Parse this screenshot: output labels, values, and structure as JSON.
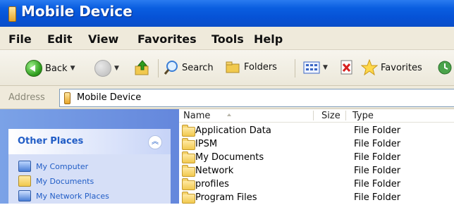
{
  "window": {
    "title": "Mobile Device"
  },
  "menubar": {
    "items": [
      "File",
      "Edit",
      "View",
      "Favorites",
      "Tools",
      "Help"
    ]
  },
  "toolbar": {
    "back_label": "Back",
    "search_label": "Search",
    "folders_label": "Folders",
    "favorites_label": "Favorites"
  },
  "address": {
    "label": "Address",
    "value": "Mobile Device"
  },
  "other_places": {
    "title": "Other Places",
    "items": [
      "My Computer",
      "My Documents",
      "My Network Places"
    ]
  },
  "file_list": {
    "columns": {
      "name": "Name",
      "size": "Size",
      "type": "Type"
    },
    "rows": [
      {
        "name": "Application Data",
        "type": "File Folder"
      },
      {
        "name": "IPSM",
        "type": "File Folder"
      },
      {
        "name": "My Documents",
        "type": "File Folder"
      },
      {
        "name": "Network",
        "type": "File Folder"
      },
      {
        "name": "profiles",
        "type": "File Folder"
      },
      {
        "name": "Program Files",
        "type": "File Folder"
      }
    ]
  },
  "colors": {
    "titlebar": "#0a5ee0",
    "menubar": "#efeadb",
    "sidepane": "#6f93e0",
    "link": "#215dc6"
  }
}
